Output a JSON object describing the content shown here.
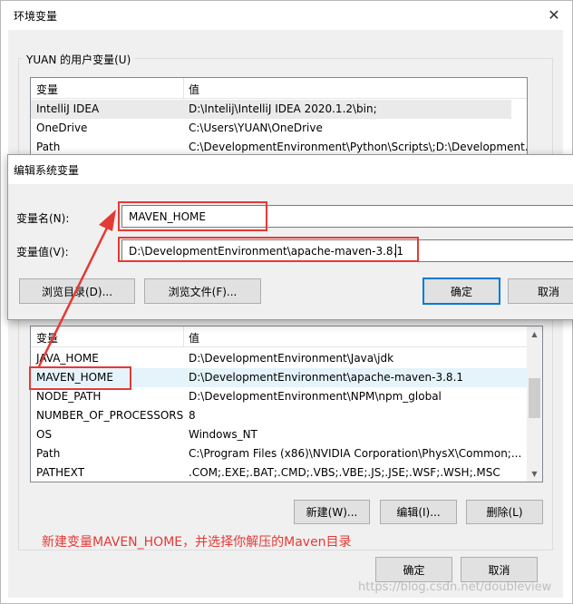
{
  "env_dialog": {
    "title": "环境变量",
    "close_glyph": "✕",
    "user_group": {
      "label": "YUAN 的用户变量(U)",
      "columns": [
        "变量",
        "值"
      ],
      "rows": [
        {
          "name": "IntelliJ IDEA",
          "value": "D:\\Intelij\\IntelliJ IDEA 2020.1.2\\bin;"
        },
        {
          "name": "OneDrive",
          "value": "C:\\Users\\YUAN\\OneDrive"
        },
        {
          "name": "Path",
          "value": "C:\\DevelopmentEnvironment\\Python\\Scripts\\;D:\\Development..."
        }
      ]
    },
    "system_group": {
      "columns": [
        "变量",
        "值"
      ],
      "rows": [
        {
          "name": "JAVA_HOME",
          "value": "D:\\DevelopmentEnvironment\\Java\\jdk"
        },
        {
          "name": "MAVEN_HOME",
          "value": "D:\\DevelopmentEnvironment\\apache-maven-3.8.1"
        },
        {
          "name": "NODE_PATH",
          "value": "D:\\DevelopmentEnvironment\\NPM\\npm_global"
        },
        {
          "name": "NUMBER_OF_PROCESSORS",
          "value": "8"
        },
        {
          "name": "OS",
          "value": "Windows_NT"
        },
        {
          "name": "Path",
          "value": "C:\\Program Files (x86)\\NVIDIA Corporation\\PhysX\\Common;..."
        },
        {
          "name": "PATHEXT",
          "value": ".COM;.EXE;.BAT;.CMD;.VBS;.VBE;.JS;.JSE;.WSF;.WSH;.MSC"
        }
      ],
      "buttons": {
        "new": "新建(W)...",
        "edit": "编辑(I)...",
        "delete": "删除(L)"
      }
    },
    "annotation": "新建变量MAVEN_HOME，并选择你解压的Maven目录",
    "ok": "确定",
    "cancel": "取消",
    "watermark": "https://blog.csdn.net/doubleview"
  },
  "edit_dialog": {
    "title": "编辑系统变量",
    "name_label": "变量名(N):",
    "name_value": "MAVEN_HOME",
    "value_label": "变量值(V):",
    "value_value": "D:\\DevelopmentEnvironment\\apache-maven-3.8.1",
    "browse_dir": "浏览目录(D)...",
    "browse_file": "浏览文件(F)...",
    "ok": "确定",
    "cancel": "取消"
  },
  "colors": {
    "annotation": "#e53935",
    "selection": "#e5f3fb",
    "default_button_border": "#0078d7"
  }
}
